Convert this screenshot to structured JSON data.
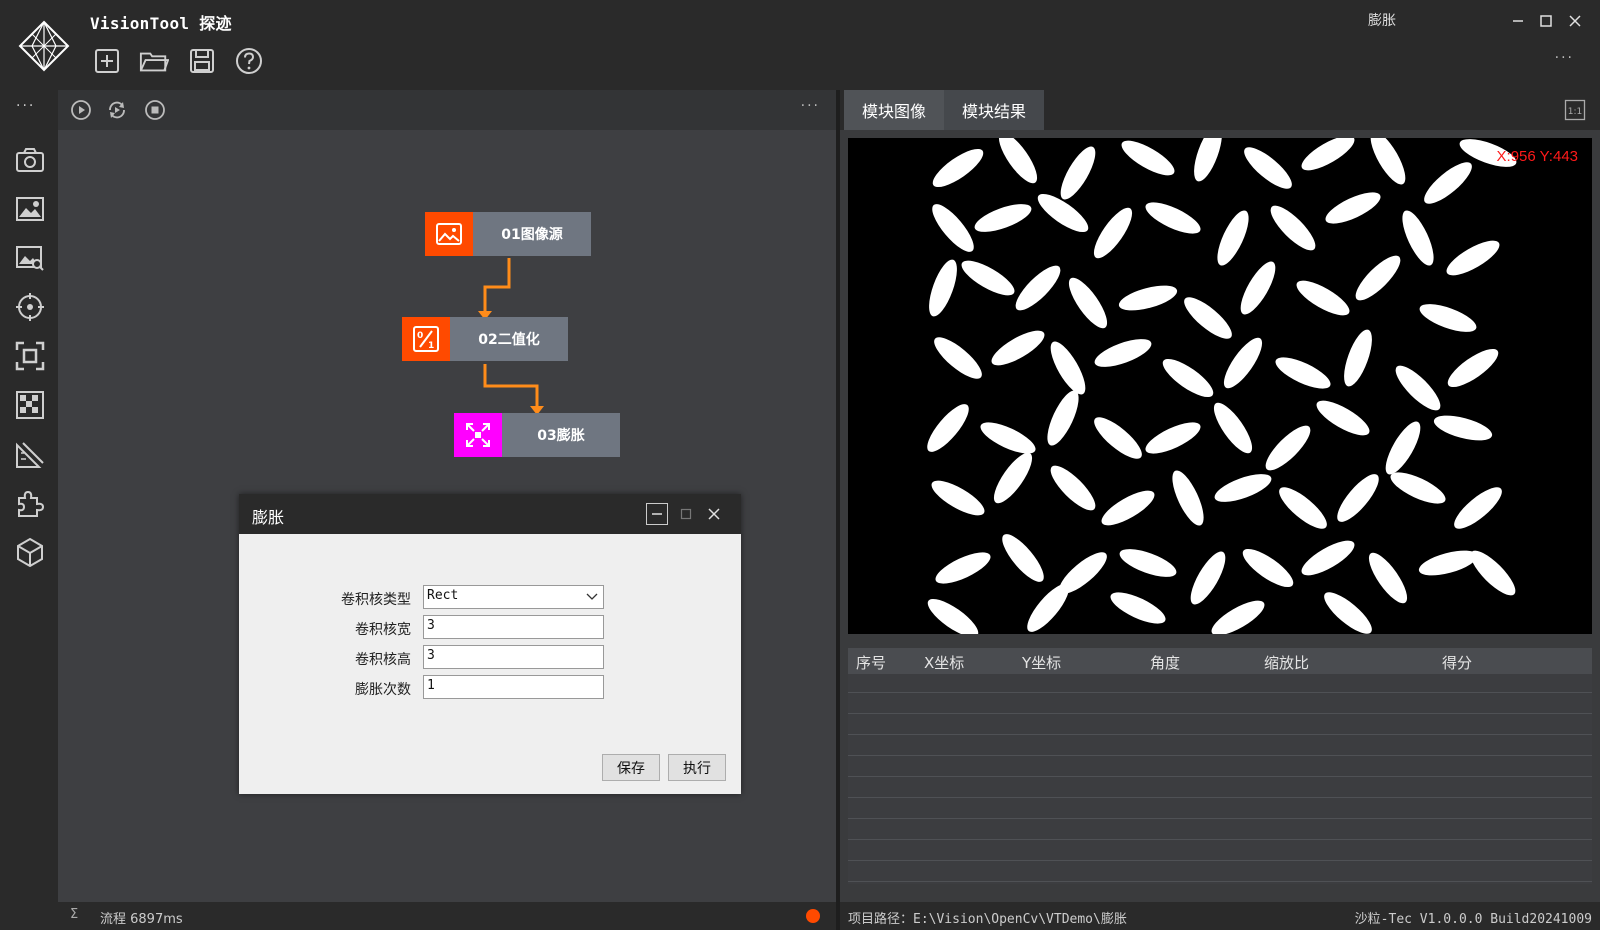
{
  "app": {
    "title": "VisionTool 探迹",
    "window_name": "膨胀",
    "more": "···"
  },
  "toolbar": {
    "icons": [
      "new-file-icon",
      "open-folder-icon",
      "save-icon",
      "help-icon"
    ]
  },
  "sidebar": {
    "more": "···",
    "icons": [
      "camera-icon",
      "image-settings-icon",
      "image-search-icon",
      "target-icon",
      "focus-frame-icon",
      "pattern-grid-icon",
      "ruler-icon",
      "puzzle-icon",
      "cube-icon"
    ]
  },
  "flow": {
    "more": "···",
    "controls": [
      "play-icon",
      "loop-icon",
      "stop-icon"
    ],
    "nodes": [
      {
        "label": "01图像源",
        "color": "#ff4a00",
        "icon": "image-icon"
      },
      {
        "label": "02二值化",
        "color": "#ff4a00",
        "icon": "binarize-icon"
      },
      {
        "label": "03膨胀",
        "color": "#ff00ff",
        "icon": "expand-icon"
      }
    ],
    "status": {
      "sigma": "Σ",
      "text": "流程 6897ms",
      "dot_color": "#ff4a00"
    }
  },
  "dialog": {
    "title": "膨胀",
    "fields": [
      {
        "label": "卷积核类型",
        "value": "Rect",
        "type": "select"
      },
      {
        "label": "卷积核宽",
        "value": "3",
        "type": "text"
      },
      {
        "label": "卷积核高",
        "value": "3",
        "type": "text"
      },
      {
        "label": "膨胀次数",
        "value": "1",
        "type": "text"
      }
    ],
    "save_label": "保存",
    "run_label": "执行"
  },
  "right": {
    "tabs": [
      {
        "label": "模块图像"
      },
      {
        "label": "模块结果"
      }
    ],
    "ratio_label": "1:1",
    "coord": "X:956 Y:443",
    "columns": [
      "序号",
      "X坐标",
      "Y坐标",
      "角度",
      "缩放比",
      "得分"
    ]
  },
  "statusbar": {
    "path": "项目路径：E:\\Vision\\OpenCv\\VTDemo\\膨胀",
    "version": "沙粒-Tec V1.0.0.0 Build20241009"
  },
  "colors": {
    "accent": "#ff4a00",
    "magenta": "#ff00ff",
    "node_label": "#6f7681",
    "arrow": "#ff8c1a"
  }
}
